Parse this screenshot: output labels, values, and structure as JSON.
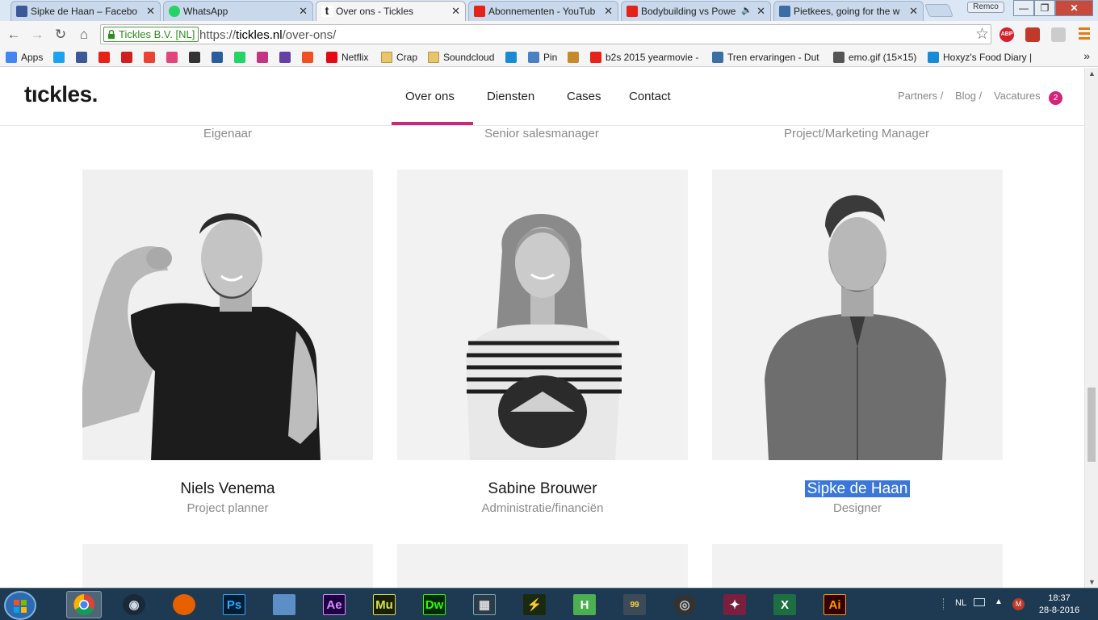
{
  "browser": {
    "tabs": [
      {
        "title": "Sipke de Haan – Facebo",
        "icon": "facebook-icon",
        "color": "#3b5998"
      },
      {
        "title": "WhatsApp",
        "icon": "whatsapp-icon",
        "color": "#25d366"
      },
      {
        "title": "Over ons - Tickles",
        "icon": "tickles-icon",
        "color": "#222222",
        "active": true
      },
      {
        "title": "Abonnementen - YouTub",
        "icon": "youtube-icon",
        "color": "#e62117"
      },
      {
        "title": "Bodybuilding vs Powe",
        "icon": "youtube-icon",
        "color": "#e62117"
      },
      {
        "title": "Pietkees, going for the w",
        "icon": "generic-page-icon",
        "color": "#3a6ea5"
      }
    ],
    "user": "Remco",
    "secure_label": "Tickles B.V. [NL]",
    "url_scheme": "https://",
    "url_host": "tickles.nl",
    "url_path": "/over-ons/",
    "bookmarks": [
      {
        "label": "Apps",
        "icon": "apps-grid-icon",
        "color": "#4285f4"
      },
      {
        "label": "",
        "icon": "twitter-icon",
        "color": "#1da1f2"
      },
      {
        "label": "",
        "icon": "facebook-icon",
        "color": "#3b5998"
      },
      {
        "label": "",
        "icon": "youtube-icon",
        "color": "#e62117"
      },
      {
        "label": "",
        "icon": "dumpert-icon",
        "color": "#d11f1f"
      },
      {
        "label": "",
        "icon": "google-icon",
        "color": "#ea4335"
      },
      {
        "label": "",
        "icon": "weheartit-icon",
        "color": "#e0457b"
      },
      {
        "label": "",
        "icon": "bodybuilding-icon",
        "color": "#333333"
      },
      {
        "label": "",
        "icon": "hyves-icon",
        "color": "#2a5d9c"
      },
      {
        "label": "",
        "icon": "whatsapp-icon",
        "color": "#25d366"
      },
      {
        "label": "",
        "icon": "instagram-icon",
        "color": "#c13584"
      },
      {
        "label": "",
        "icon": "twitch-icon",
        "color": "#6441a5"
      },
      {
        "label": "",
        "icon": "microsoft-icon",
        "color": "#f25022"
      },
      {
        "label": "Netflix",
        "icon": "netflix-icon",
        "color": "#e50914"
      },
      {
        "label": "Crap",
        "icon": "folder-icon",
        "color": "#e8c46a"
      },
      {
        "label": "Soundcloud",
        "icon": "folder-icon",
        "color": "#e8c46a"
      },
      {
        "label": "",
        "icon": "xing-icon",
        "color": "#1a8ad4"
      },
      {
        "label": "Pin",
        "icon": "pin-icon",
        "color": "#4a7fc1"
      },
      {
        "label": "",
        "icon": "cookie-icon",
        "color": "#c58a2e"
      },
      {
        "label": "b2s 2015 yearmovie -",
        "icon": "youtube-icon",
        "color": "#e62117"
      },
      {
        "label": "Tren ervaringen - Dut",
        "icon": "generic-page-icon",
        "color": "#3a6ea5"
      },
      {
        "label": "emo.gif (15×15)",
        "icon": "emo-icon",
        "color": "#555555"
      },
      {
        "label": "Hoxyz's Food Diary |",
        "icon": "xing-icon",
        "color": "#1a8ad4"
      }
    ]
  },
  "site": {
    "logo": "tıckles.",
    "nav": [
      "Over ons",
      "Diensten",
      "Cases",
      "Contact"
    ],
    "subnav": [
      "Partners /",
      "Blog /",
      "Vacatures"
    ],
    "vacatures_count": "2",
    "accent": "#d3247b",
    "top_roles": [
      "Eigenaar",
      "Senior salesmanager",
      "Project/Marketing Manager"
    ],
    "team": [
      {
        "name": "Niels Venema",
        "role": "Project planner"
      },
      {
        "name": "Sabine Brouwer",
        "role": "Administratie/financiën"
      },
      {
        "name": "Sipke de Haan",
        "role": "Designer",
        "selected": true
      }
    ]
  },
  "taskbar": {
    "apps": [
      "chrome-icon",
      "steam-icon",
      "firefox-icon",
      "photoshop-icon",
      "network-icon",
      "after-effects-icon",
      "muse-icon",
      "dreamweaver-icon",
      "video-editor-icon",
      "winamp-icon",
      "h-app-icon",
      "notepad-99-icon",
      "cycle-app-icon",
      "game-app-icon",
      "excel-icon",
      "illustrator-icon"
    ],
    "labels": {
      "ps": "Ps",
      "ae": "Ae",
      "mu": "Mu",
      "dw": "Dw",
      "ai": "Ai",
      "h": "H",
      "x": "X",
      "n99": "99"
    },
    "lang": "NL",
    "time": "18:37",
    "date": "28-8-2016"
  }
}
